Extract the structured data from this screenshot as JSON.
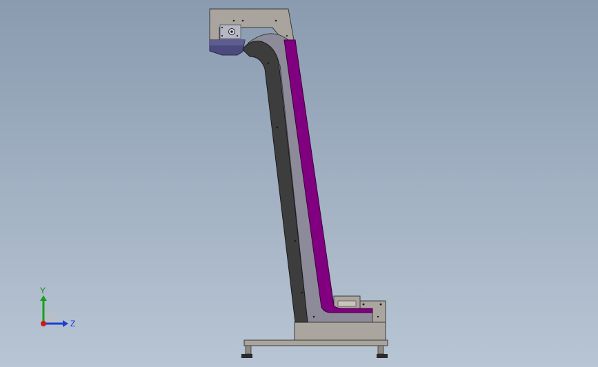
{
  "viewport": {
    "background_top": "#8a9bb0",
    "background_bottom": "#b8c5d4"
  },
  "model": {
    "frame_color": "#8d8b98",
    "belt_dark_color": "#3a3a3a",
    "side_panel_color": "#800080",
    "housing_color": "#a7a39d",
    "inlet_color": "#48487a"
  },
  "triad": {
    "y_label": "Y",
    "z_label": "Z",
    "y_color": "#18a018",
    "z_color": "#1c3fd0",
    "x_color": "#d01818"
  }
}
